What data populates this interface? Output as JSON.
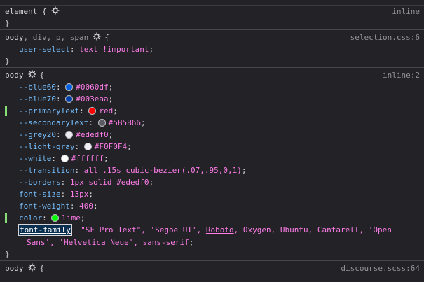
{
  "rules": [
    {
      "selector": "element",
      "brace_open": "{",
      "brace_close": "}",
      "source": "inline",
      "declarations": []
    },
    {
      "selector_parts": [
        "body",
        ", div, p, span"
      ],
      "brace_open": "{",
      "brace_close": "}",
      "source": "selection.css:6",
      "declarations": [
        {
          "prop": "user-select",
          "value": "text !important",
          "semi": ";"
        }
      ]
    },
    {
      "selector": "body",
      "brace_open": "{",
      "brace_close": "}",
      "source": "inline:2",
      "declarations": [
        {
          "prop": "--blue60",
          "value": "#0060df",
          "semi": ";",
          "swatch": "#0060df"
        },
        {
          "prop": "--blue70",
          "value": "#003eaa",
          "semi": ";",
          "swatch": "#003eaa"
        },
        {
          "prop": "--primaryText",
          "value": "red",
          "semi": ";",
          "swatch": "#ff0000"
        },
        {
          "prop": "--secondaryText",
          "value": "#5B5B66",
          "semi": ";",
          "swatch": "#5b5b66"
        },
        {
          "prop": "--grey20",
          "value": "#ededf0",
          "semi": ";",
          "swatch": "#ededf0"
        },
        {
          "prop": "--light-gray",
          "value": "#F0F0F4",
          "semi": ";",
          "swatch": "#f0f0f4"
        },
        {
          "prop": "--white",
          "value": "#ffffff",
          "semi": ";",
          "swatch": "#ffffff"
        },
        {
          "prop": "--transition",
          "value": "all .15s cubic-bezier(.07,.95,0,1)",
          "semi": ";"
        },
        {
          "prop": "--borders",
          "value": "1px solid #ededf0",
          "semi": ";"
        },
        {
          "prop": "font-size",
          "value": "13px",
          "semi": ";"
        },
        {
          "prop": "font-weight",
          "value": "400",
          "semi": ";"
        },
        {
          "prop": "color",
          "value": "lime",
          "semi": ";",
          "swatch": "#00ff00"
        },
        {
          "prop": "font-family",
          "value_line1_a": "\"SF Pro Text\", 'Segoe UI', ",
          "value_link": "Roboto",
          "value_line1_b": ", Oxygen, Ubuntu, Cantarell, 'Open",
          "value_line2": "Sans', 'Helvetica Neue', sans-serif",
          "semi": ";"
        }
      ]
    },
    {
      "selector": "body",
      "brace_open": "{",
      "source": "discourse.scss:64"
    }
  ],
  "colors": {
    "background": "#232327",
    "property": "#75bfff",
    "value": "#ff7de9",
    "changed_marker": "#86de74",
    "source": "#939395"
  },
  "icons": {
    "selector_gear": "gear-icon"
  }
}
